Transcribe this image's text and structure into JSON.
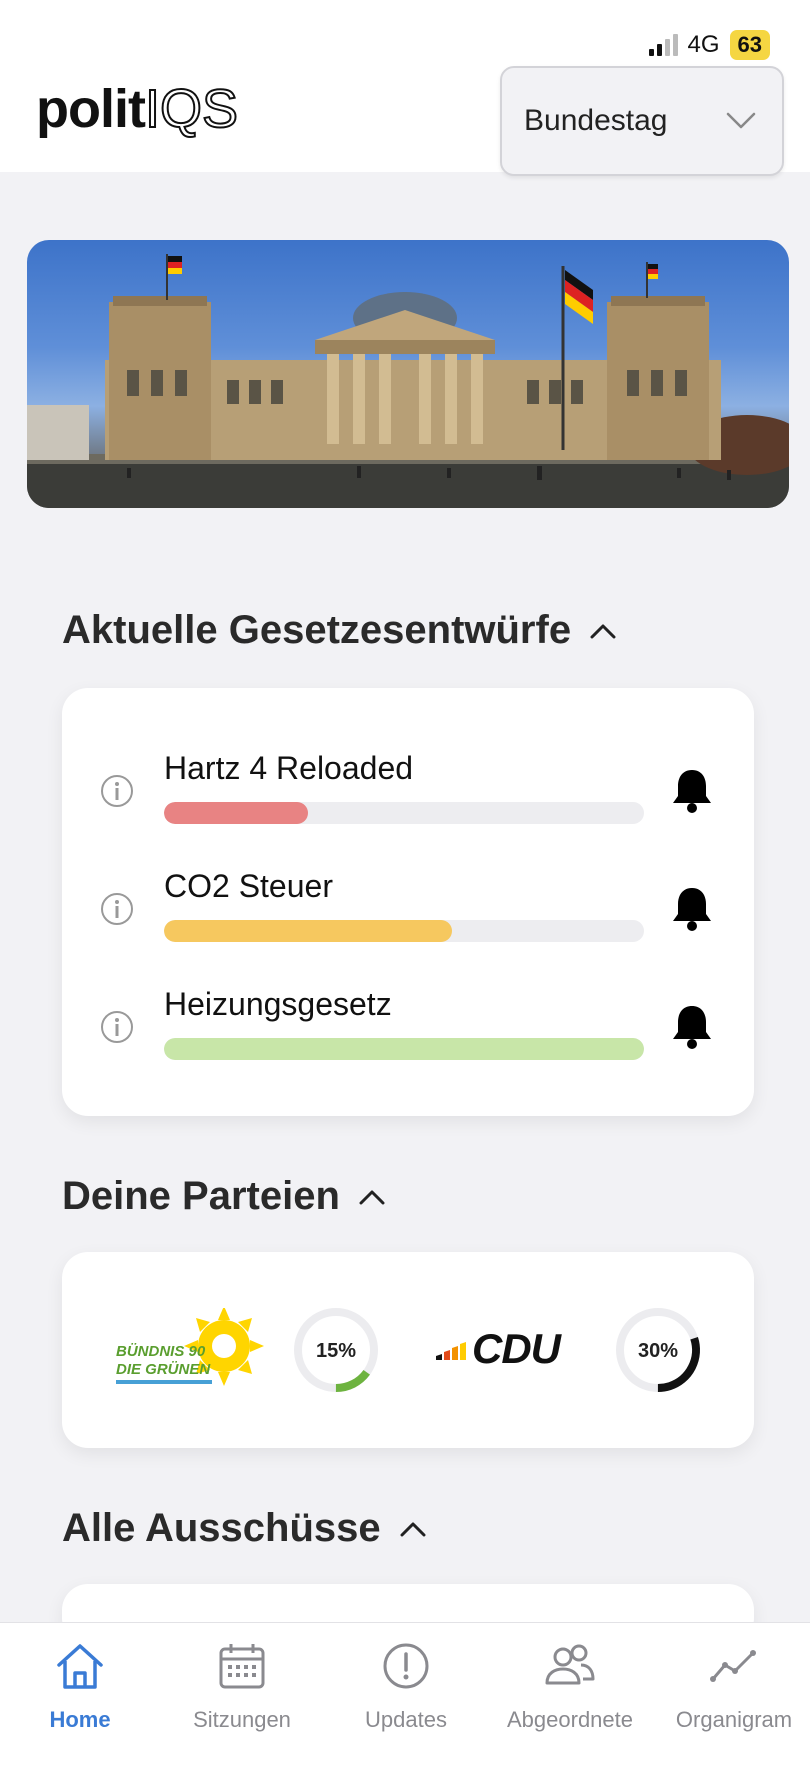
{
  "status_bar": {
    "network": "4G",
    "battery": "63"
  },
  "header": {
    "logo_part1": "polit",
    "logo_part2": "IQS",
    "parliament_select": "Bundestag"
  },
  "sections": {
    "laws_title": "Aktuelle Gesetzesentwürfe",
    "parties_title": "Deine Parteien",
    "committees_title": "Alle Ausschüsse"
  },
  "laws": [
    {
      "name": "Hartz 4 Reloaded",
      "progress": 0.3,
      "color": "#e88383"
    },
    {
      "name": "CO2 Steuer",
      "progress": 0.6,
      "color": "#f6c85f"
    },
    {
      "name": "Heizungsgesetz",
      "progress": 1.0,
      "color": "#c8e6a8"
    }
  ],
  "parties": [
    {
      "logo_line1": "BÜNDNIS 90",
      "logo_line2": "DIE GRÜNEN",
      "percent_label": "15%",
      "value": 0.15,
      "color": "#6db33f"
    },
    {
      "logo_text": "CDU",
      "percent_label": "30%",
      "value": 0.3,
      "color": "#111111"
    }
  ],
  "tabs": [
    {
      "label": "Home",
      "icon": "home-icon"
    },
    {
      "label": "Sitzungen",
      "icon": "calendar-icon"
    },
    {
      "label": "Updates",
      "icon": "alert-icon"
    },
    {
      "label": "Abgeordnete",
      "icon": "people-icon"
    },
    {
      "label": "Organigram",
      "icon": "trend-icon"
    }
  ]
}
